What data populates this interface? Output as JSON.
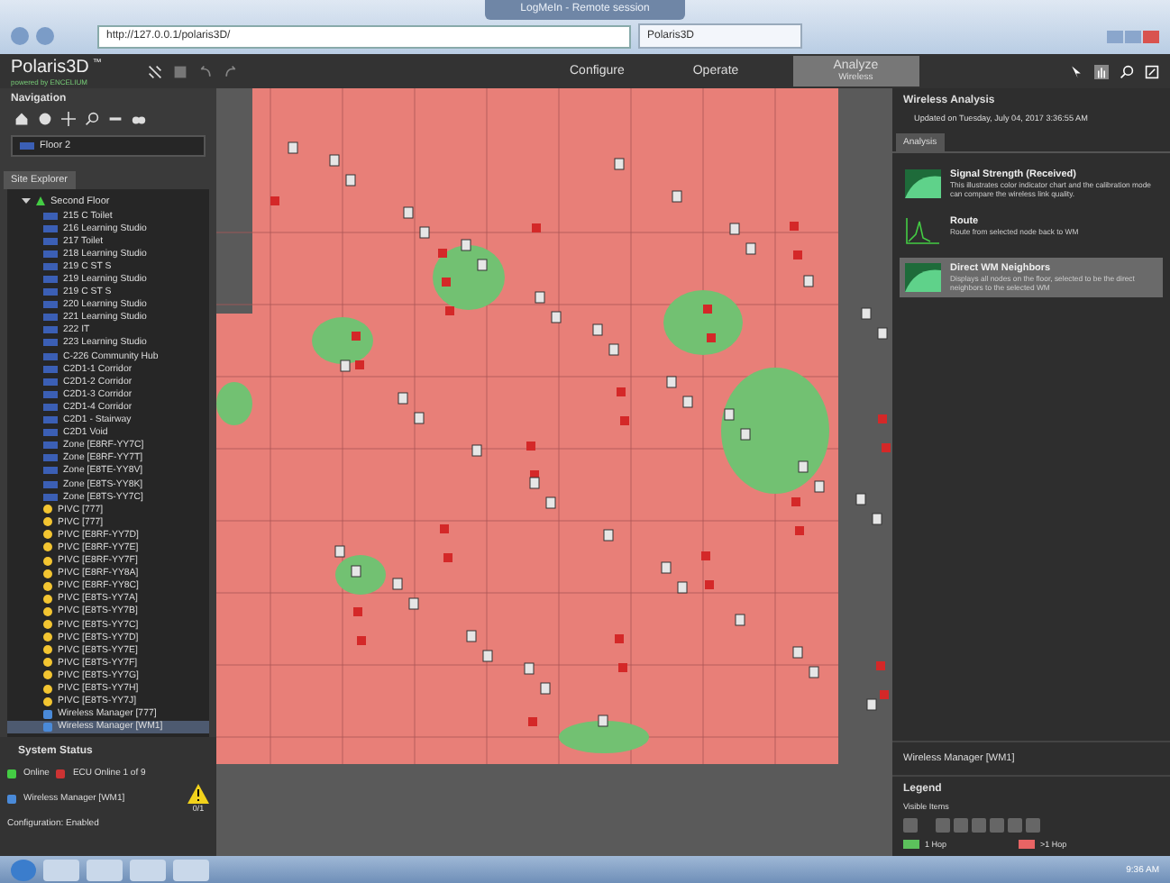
{
  "browser": {
    "session_title": "LogMeIn - Remote session",
    "address": "http://127.0.0.1/polaris3D/",
    "tab_title": "Polaris3D"
  },
  "app": {
    "logo": "Polaris3D",
    "logo_mark": "™",
    "powered_by": "powered by ENCELIUM",
    "modes": [
      {
        "label": "Configure",
        "selected": false
      },
      {
        "label": "Operate",
        "selected": false
      },
      {
        "label": "Analyze",
        "sub": "Wireless",
        "selected": true
      }
    ]
  },
  "navigation": {
    "title": "Navigation",
    "floor": "Floor 2",
    "tab": "Site Explorer",
    "tree": {
      "label": "Second Floor",
      "expanded": true,
      "children": [
        {
          "kind": "zone",
          "label": "215 C Toilet",
          "selected": false
        },
        {
          "kind": "zone",
          "label": "216 Learning Studio",
          "selected": false
        },
        {
          "kind": "zone",
          "label": "217 Toilet",
          "selected": false
        },
        {
          "kind": "zone",
          "label": "218 Learning Studio",
          "selected": false
        },
        {
          "kind": "zone",
          "label": "219 C ST S",
          "selected": false
        },
        {
          "kind": "zone",
          "label": "219 Learning Studio",
          "selected": false
        },
        {
          "kind": "zone",
          "label": "219 C ST S",
          "selected": false
        },
        {
          "kind": "zone",
          "label": "220 Learning Studio",
          "selected": false
        },
        {
          "kind": "zone",
          "label": "221 Learning Studio",
          "selected": false
        },
        {
          "kind": "zone",
          "label": "222 IT",
          "selected": false
        },
        {
          "kind": "zone",
          "label": "223 Learning Studio",
          "selected": false
        },
        {
          "kind": "zone",
          "label": "C-226 Community Hub",
          "selected": false
        },
        {
          "kind": "zone",
          "label": "C2D1-1 Corridor",
          "selected": false
        },
        {
          "kind": "zone",
          "label": "C2D1-2 Corridor",
          "selected": false
        },
        {
          "kind": "zone",
          "label": "C2D1-3 Corridor",
          "selected": false
        },
        {
          "kind": "zone",
          "label": "C2D1-4 Corridor",
          "selected": false
        },
        {
          "kind": "zone",
          "label": "C2D1 - Stairway",
          "selected": false
        },
        {
          "kind": "zone",
          "label": "C2D1 Void",
          "selected": false
        },
        {
          "kind": "zone",
          "label": "Zone [E8RF-YY7C]",
          "selected": false
        },
        {
          "kind": "zone",
          "label": "Zone [E8RF-YY7T]",
          "selected": false
        },
        {
          "kind": "zone",
          "label": "Zone [E8TE-YY8V]",
          "selected": false
        },
        {
          "kind": "zone",
          "label": "Zone [E8TS-YY8K]",
          "selected": false
        },
        {
          "kind": "zone",
          "label": "Zone [E8TS-YY7C]",
          "selected": false
        },
        {
          "kind": "device",
          "label": "PIVC [777]",
          "selected": false
        },
        {
          "kind": "device",
          "label": "PIVC [777]",
          "selected": false
        },
        {
          "kind": "device",
          "label": "PIVC [E8RF-YY7D]",
          "selected": false
        },
        {
          "kind": "device",
          "label": "PIVC [E8RF-YY7E]",
          "selected": false
        },
        {
          "kind": "device",
          "label": "PIVC [E8RF-YY7F]",
          "selected": false
        },
        {
          "kind": "device",
          "label": "PIVC [E8RF-YY8A]",
          "selected": false
        },
        {
          "kind": "device",
          "label": "PIVC [E8RF-YY8C]",
          "selected": false
        },
        {
          "kind": "device",
          "label": "PIVC [E8TS-YY7A]",
          "selected": false
        },
        {
          "kind": "device",
          "label": "PIVC [E8TS-YY7B]",
          "selected": false
        },
        {
          "kind": "device",
          "label": "PIVC [E8TS-YY7C]",
          "selected": false
        },
        {
          "kind": "device",
          "label": "PIVC [E8TS-YY7D]",
          "selected": false
        },
        {
          "kind": "device",
          "label": "PIVC [E8TS-YY7E]",
          "selected": false
        },
        {
          "kind": "device",
          "label": "PIVC [E8TS-YY7F]",
          "selected": false
        },
        {
          "kind": "device",
          "label": "PIVC [E8TS-YY7G]",
          "selected": false
        },
        {
          "kind": "device",
          "label": "PIVC [E8TS-YY7H]",
          "selected": false
        },
        {
          "kind": "device",
          "label": "PIVC [E8TS-YY7J]",
          "selected": false
        },
        {
          "kind": "manager",
          "label": "Wireless Manager [777]",
          "selected": false
        },
        {
          "kind": "manager",
          "label": "Wireless Manager [WM1]",
          "selected": true
        }
      ]
    }
  },
  "system_status": {
    "title": "System Status",
    "online": "Online",
    "ecu": "ECU Online 1 of 9",
    "manager": "Wireless Manager [WM1]",
    "warning": "0/1",
    "footer": "Configuration: Enabled"
  },
  "wireless_analysis": {
    "title": "Wireless Analysis",
    "updated": "Updated on Tuesday, July 04, 2017 3:36:55 AM",
    "tab": "Analysis",
    "items": [
      {
        "kind": "signal",
        "title": "Signal Strength (Received)",
        "description": "This illustrates color indicator chart and the calibration mode can compare the wireless link quality.",
        "selected": false
      },
      {
        "kind": "route",
        "title": "Route",
        "description": "Route from selected node back to WM",
        "selected": false
      },
      {
        "kind": "signal",
        "title": "Direct WM Neighbors",
        "description": "Displays all nodes on the floor, selected to be the direct neighbors to the selected WM",
        "selected": true
      }
    ],
    "manager": "Wireless Manager [WM1]"
  },
  "legend": {
    "title": "Legend",
    "visible_items": "Visible Items",
    "entries": [
      {
        "label": "1 Hop",
        "color": "#5cc15c"
      },
      {
        "label": ">1 Hop",
        "color": "#e86464"
      }
    ]
  },
  "taskbar": {
    "clock": "9:36 AM"
  }
}
